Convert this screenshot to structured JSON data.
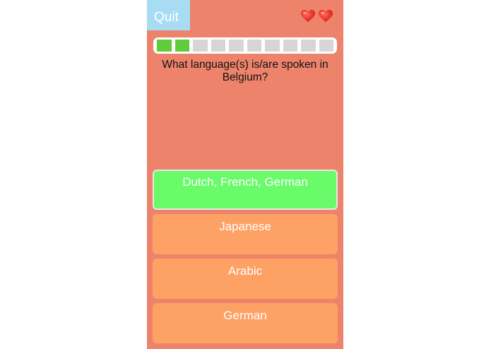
{
  "header": {
    "quit_label": "Quit",
    "lives": [
      "heart-icon",
      "heart-icon"
    ]
  },
  "progress": {
    "completed": 2,
    "total": 10
  },
  "question": {
    "text": "What language(s) is/are spoken in Belgium?"
  },
  "answers": [
    {
      "label": "Dutch, French, German",
      "state": "correct"
    },
    {
      "label": "Japanese",
      "state": "default"
    },
    {
      "label": "Arabic",
      "state": "default"
    },
    {
      "label": "German",
      "state": "default"
    }
  ],
  "colors": {
    "background": "#ee836b",
    "quit_button": "#a7dcf3",
    "progress_done": "#5fcc3a",
    "progress_pending": "#d6d6d6",
    "answer_default": "#fda165",
    "answer_correct": "#69fb69",
    "heart": "#e8201a"
  }
}
